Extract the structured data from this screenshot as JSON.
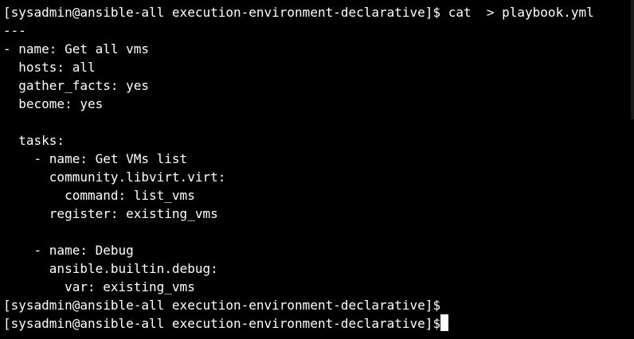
{
  "terminal": {
    "colors": {
      "background": "#000000",
      "foreground": "#ffffff",
      "cursor": "#ffffff"
    },
    "lines": [
      "[sysadmin@ansible-all execution-environment-declarative]$ cat  > playbook.yml",
      "---",
      "- name: Get all vms",
      "  hosts: all",
      "  gather_facts: yes",
      "  become: yes",
      "",
      "  tasks:",
      "    - name: Get VMs list",
      "      community.libvirt.virt:",
      "        command: list_vms",
      "      register: existing_vms",
      "",
      "    - name: Debug",
      "      ansible.builtin.debug:",
      "        var: existing_vms",
      "[sysadmin@ansible-all execution-environment-declarative]$",
      "[sysadmin@ansible-all execution-environment-declarative]$"
    ]
  }
}
